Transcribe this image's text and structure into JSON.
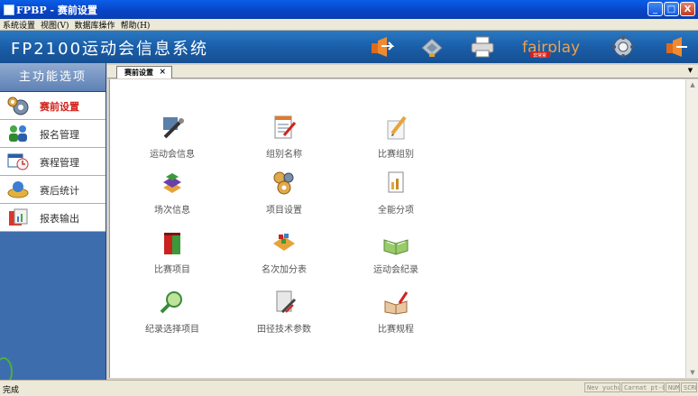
{
  "window": {
    "title": "FPBP - 赛前设置",
    "min": "_",
    "max": "□",
    "close": "X"
  },
  "menu": [
    "系统设置",
    "视图(V)",
    "数据库操作",
    "帮助(H)"
  ],
  "header": {
    "title": "FP2100运动会信息系统",
    "logo_text": "fairplay",
    "logo_sub": "非常累"
  },
  "sidebar": {
    "title": "主功能选项",
    "items": [
      {
        "label": "赛前设置",
        "active": true
      },
      {
        "label": "报名管理"
      },
      {
        "label": "赛程管理"
      },
      {
        "label": "赛后统计"
      },
      {
        "label": "报表输出"
      }
    ]
  },
  "tab": {
    "label": "赛前设置",
    "close": "×"
  },
  "grid": [
    {
      "label": "运动会信息"
    },
    {
      "label": "组别名称"
    },
    {
      "label": "比赛组别"
    },
    {
      "label": "场次信息"
    },
    {
      "label": "项目设置"
    },
    {
      "label": "全能分项"
    },
    {
      "label": "比赛项目"
    },
    {
      "label": "名次加分表"
    },
    {
      "label": "运动会纪录"
    },
    {
      "label": "纪录选择项目"
    },
    {
      "label": "田径技术参数"
    },
    {
      "label": "比赛规程"
    }
  ],
  "status": {
    "text": "完成",
    "panels": [
      "Nev yuchugs",
      "Carnat pt-CAT",
      "NUM",
      "SCRL"
    ]
  },
  "colors": {
    "accent_red": "#d2231c",
    "header_blue": "#1a5ea8",
    "sidebar_blue": "#3e6dae"
  }
}
